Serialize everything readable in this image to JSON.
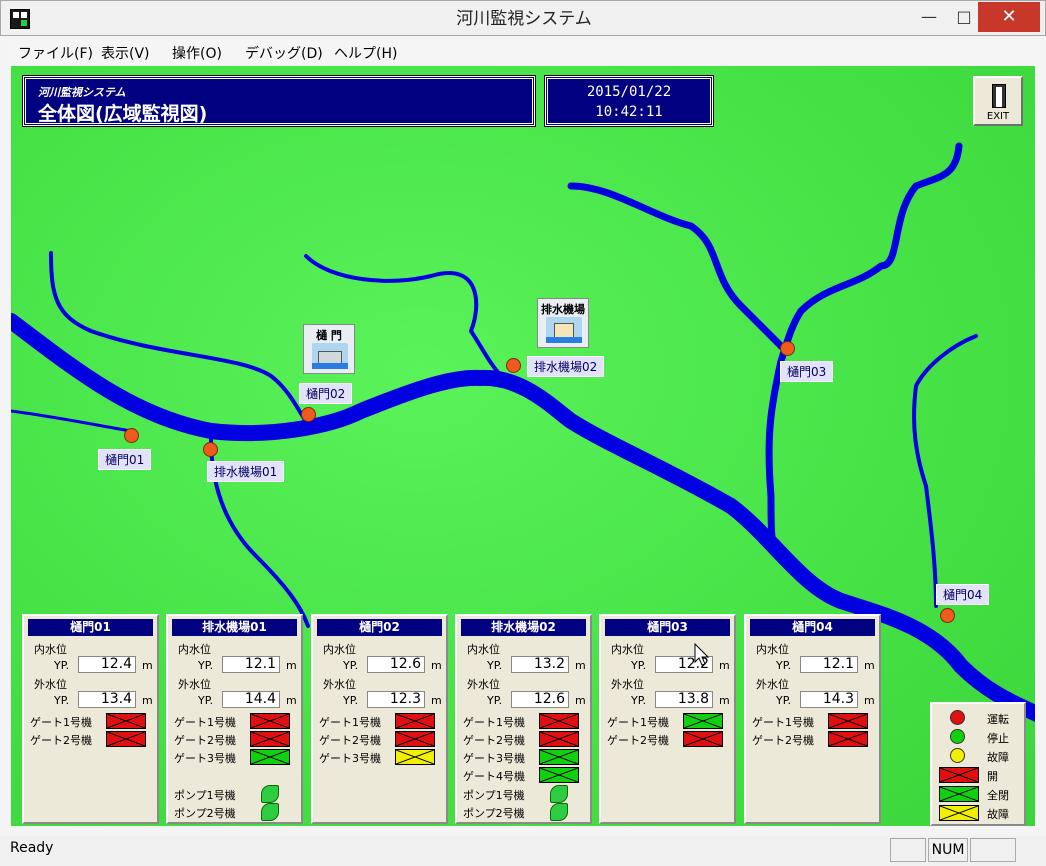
{
  "window": {
    "title": "河川監視システム",
    "min_glyph": "—",
    "max_glyph": "□",
    "close_glyph": "✕"
  },
  "menu": [
    "ファイル(F)",
    "表示(V)",
    "操作(O)",
    "デバッグ(D)",
    "ヘルプ(H)"
  ],
  "header": {
    "system_name": "河川監視システム",
    "view_title": "全体図(広域監視図)",
    "date": "2015/01/22",
    "time": "10:42:11",
    "exit_label": "EXIT"
  },
  "map": {
    "icons": {
      "gate": "樋 門",
      "pump": "排水機場"
    },
    "labels": {
      "gate01": "樋門01",
      "pump01": "排水機場01",
      "gate02": "樋門02",
      "pump02": "排水機場02",
      "gate03": "樋門03",
      "gate04": "樋門04"
    }
  },
  "common": {
    "inner_level": "内水位",
    "outer_level": "外水位",
    "yp": "YP.",
    "unit": "m"
  },
  "panels": [
    {
      "title": "樋門01",
      "inner": "12.4",
      "outer": "13.4",
      "gates": [
        {
          "label": "ゲート1号機",
          "state": "red"
        },
        {
          "label": "ゲート2号機",
          "state": "red"
        }
      ],
      "pumps": []
    },
    {
      "title": "排水機場01",
      "inner": "12.1",
      "outer": "14.4",
      "gates": [
        {
          "label": "ゲート1号機",
          "state": "red"
        },
        {
          "label": "ゲート2号機",
          "state": "red"
        },
        {
          "label": "ゲート3号機",
          "state": "green"
        }
      ],
      "pumps": [
        "ポンプ1号機",
        "ポンプ2号機"
      ]
    },
    {
      "title": "樋門02",
      "inner": "12.6",
      "outer": "12.3",
      "gates": [
        {
          "label": "ゲート1号機",
          "state": "red"
        },
        {
          "label": "ゲート2号機",
          "state": "red"
        },
        {
          "label": "ゲート3号機",
          "state": "yellow"
        }
      ],
      "pumps": []
    },
    {
      "title": "排水機場02",
      "inner": "13.2",
      "outer": "12.6",
      "gates": [
        {
          "label": "ゲート1号機",
          "state": "red"
        },
        {
          "label": "ゲート2号機",
          "state": "red"
        },
        {
          "label": "ゲート3号機",
          "state": "green"
        },
        {
          "label": "ゲート4号機",
          "state": "green"
        }
      ],
      "pumps": [
        "ポンプ1号機",
        "ポンプ2号機"
      ]
    },
    {
      "title": "樋門03",
      "inner": "12.2",
      "outer": "13.8",
      "gates": [
        {
          "label": "ゲート1号機",
          "state": "green"
        },
        {
          "label": "ゲート2号機",
          "state": "red"
        }
      ],
      "pumps": []
    },
    {
      "title": "樋門04",
      "inner": "12.1",
      "outer": "14.3",
      "gates": [
        {
          "label": "ゲート1号機",
          "state": "red"
        },
        {
          "label": "ゲート2号機",
          "state": "red"
        }
      ],
      "pumps": []
    }
  ],
  "legend": [
    {
      "label": "運転",
      "kind": "dot",
      "color": "#e01010"
    },
    {
      "label": "停止",
      "kind": "dot",
      "color": "#10d010"
    },
    {
      "label": "故障",
      "kind": "dot",
      "color": "#f0f000"
    },
    {
      "label": "開",
      "kind": "gate",
      "state": "red"
    },
    {
      "label": "全閉",
      "kind": "gate",
      "state": "green"
    },
    {
      "label": "故障",
      "kind": "gate",
      "state": "yellow"
    }
  ],
  "statusbar": {
    "text": "Ready",
    "num": "NUM"
  },
  "colors": {
    "header_bg": "#000080",
    "map_bg": "#45e145",
    "river": "#0000e0",
    "marker": "#f05a1e",
    "gate_open": "#e01010",
    "gate_closed": "#10d010",
    "gate_fault": "#f0f000"
  }
}
